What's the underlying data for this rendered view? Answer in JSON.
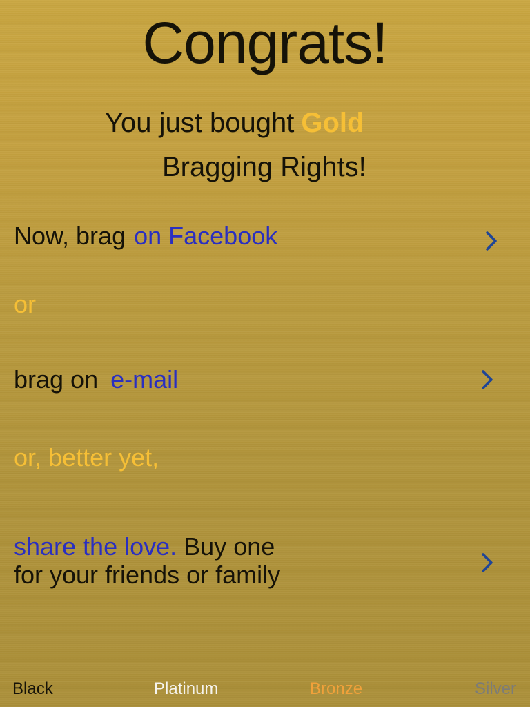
{
  "colors": {
    "gold_accent": "#f6bf36",
    "link_blue": "#2a2fc0",
    "chevron_blue": "#1f4596"
  },
  "header": {
    "title": "Congrats!"
  },
  "subtitle": {
    "line1_prefix": "You just bought",
    "tier": "Gold",
    "line2": "Bragging Rights!"
  },
  "actions": {
    "facebook": {
      "prefix": "Now, brag",
      "link": "on Facebook",
      "icon": "chevron-right-icon"
    },
    "separator1": "or",
    "email": {
      "prefix": "brag on",
      "link": "e-mail",
      "icon": "chevron-right-icon"
    },
    "separator2": "or, better yet,",
    "share": {
      "link": "share the love.",
      "text_line1": "Buy one",
      "text_line2": "for your friends or family",
      "icon": "chevron-right-icon"
    }
  },
  "tiers": [
    {
      "label": "Black",
      "color": "#161308"
    },
    {
      "label": "Platinum",
      "color": "#f6f4ee"
    },
    {
      "label": "Bronze",
      "color": "#f1a13a"
    },
    {
      "label": "Silver",
      "color": "#7c7c78"
    }
  ]
}
